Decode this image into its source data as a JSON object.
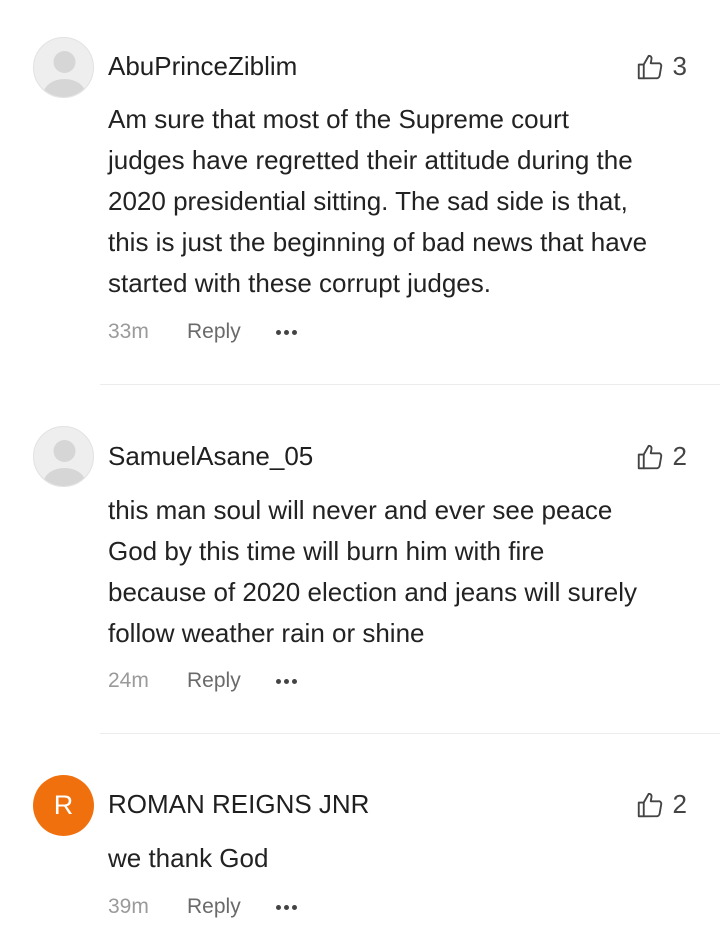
{
  "comments": [
    {
      "username": "AbuPrinceZiblim",
      "avatar_type": "generic-user-icon",
      "likes": "3",
      "text_lines": [
        "Am sure that most of the Supreme court",
        "judges have regretted their attitude during the",
        "2020 presidential sitting. The sad side is that,",
        "this is just the beginning of bad news that have",
        "started with these corrupt judges."
      ],
      "time": "33m",
      "reply_label": "Reply"
    },
    {
      "username": "SamuelAsane_05",
      "avatar_type": "generic-user-icon",
      "likes": "2",
      "text_lines": [
        "this man soul will never and ever see peace",
        "God by this time will burn him with fire",
        "because of 2020 election and jeans will surely",
        "follow weather rain or shine"
      ],
      "time": "24m",
      "reply_label": "Reply"
    },
    {
      "username": "ROMAN REIGNS JNR",
      "avatar_letter": "R",
      "avatar_color": "#f0700e",
      "likes": "2",
      "text_lines": [
        "we thank God"
      ],
      "time": "39m",
      "reply_label": "Reply"
    }
  ]
}
